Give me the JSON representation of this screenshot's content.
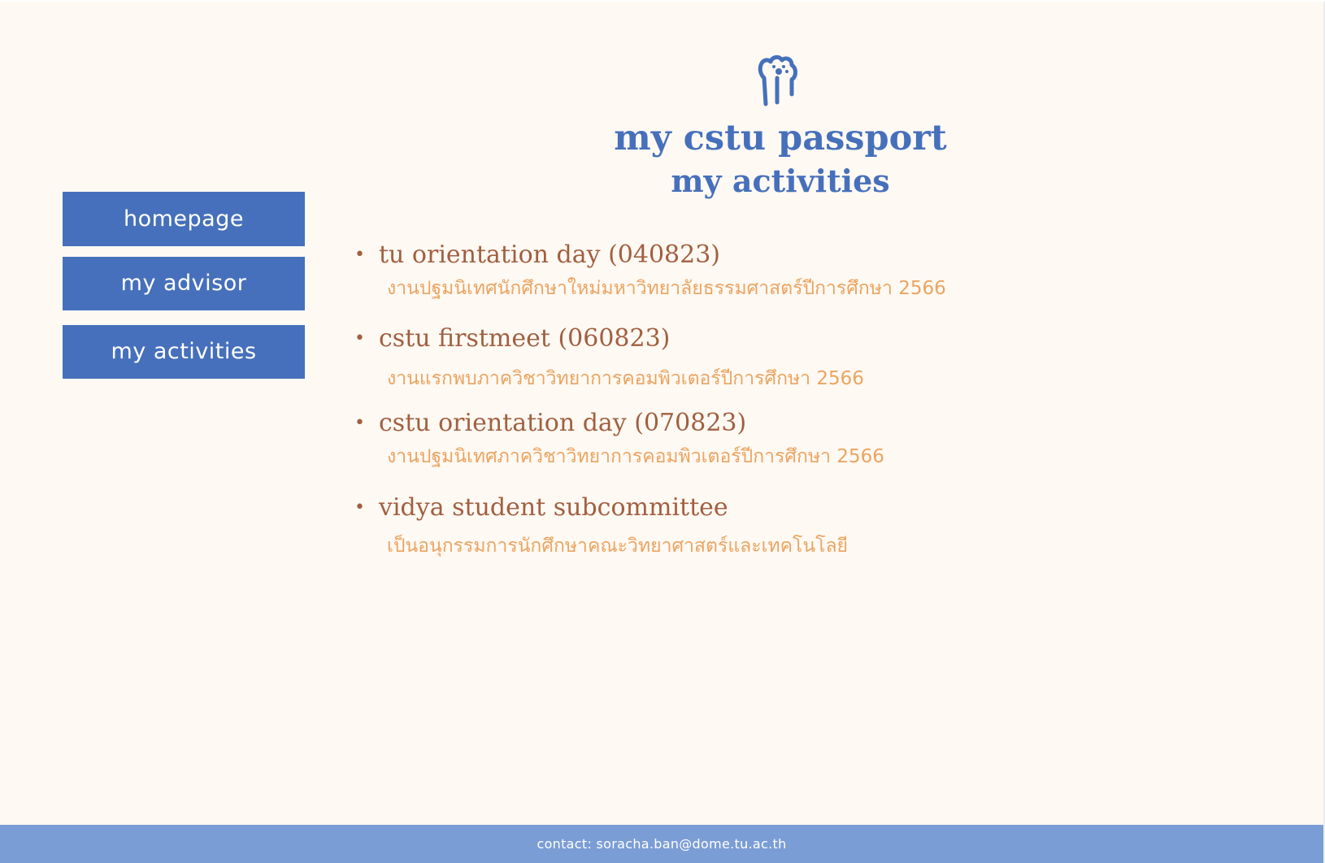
{
  "header": {
    "logo_icon": "cat-paw-icon",
    "title": "my cstu passport",
    "subtitle": "my activities"
  },
  "nav": {
    "items": [
      {
        "label": "homepage"
      },
      {
        "label": "my advisor"
      },
      {
        "label": "my activities"
      }
    ]
  },
  "activities": [
    {
      "name": "tu orientation day (040823)",
      "description": "งานปฐมนิเทศนักศึกษาใหม่มหาวิทยาลัยธรรมศาสตร์ปีการศึกษา 2566"
    },
    {
      "name": "cstu firstmeet (060823)",
      "description": "งานแรกพบภาควิชาวิทยาการคอมพิวเตอร์ปีการศึกษา 2566"
    },
    {
      "name": "cstu orientation day (070823)",
      "description": "งานปฐมนิเทศภาควิชาวิทยาการคอมพิวเตอร์ปีการศึกษา 2566"
    },
    {
      "name": "vidya student subcommittee",
      "description": "เป็นอนุกรรมการนักศึกษาคณะวิทยาศาสตร์และเทคโนโลยี"
    }
  ],
  "footer": {
    "contact": "contact: soracha.ban@dome.tu.ac.th"
  },
  "colors": {
    "background": "#fef9f3",
    "primary_blue": "#4670bb",
    "footer_blue": "#7b9dd5",
    "activity_title": "#a15f40",
    "activity_desc": "#eba461"
  }
}
